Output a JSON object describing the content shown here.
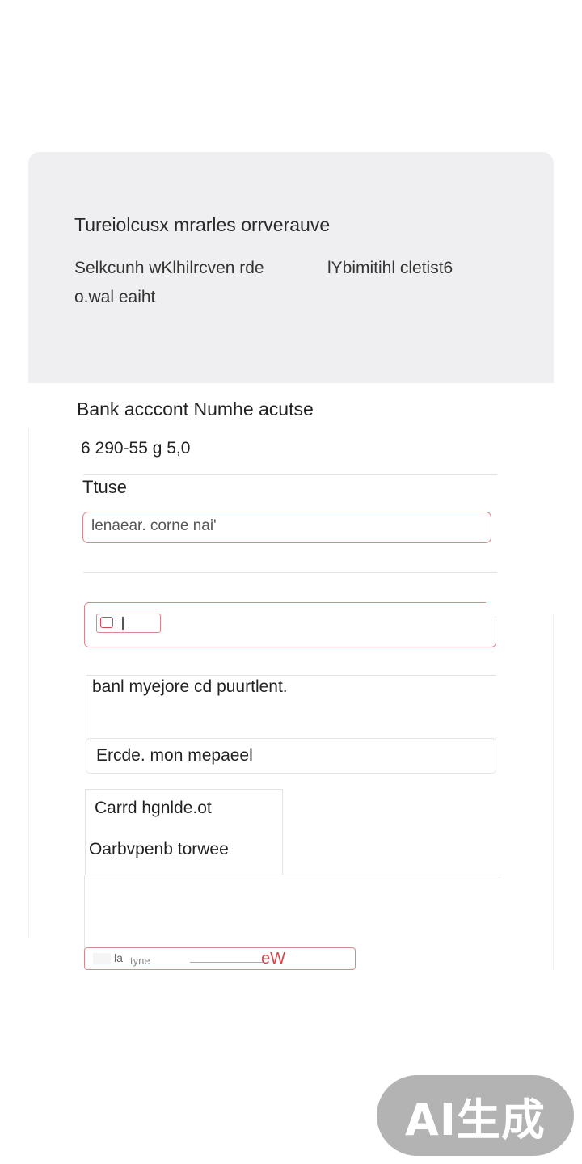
{
  "header": {
    "title": "Tureiolcusx mrarles orrverauve",
    "description_a": "Selkcunh wKlhilrcven rde",
    "description_b": "lYbimitihl cletist6",
    "description_c": "o.wal eaiht"
  },
  "form": {
    "bank_account_label": "Bank acccont Numhe acutse",
    "bank_account_value": "6 290-55 g 5,0",
    "field_label": "Ttuse",
    "field_input_value": "lenaear. corne nai'",
    "note_text": "banl myejore cd puurtlent.",
    "expire_input_value": "Ercde. mon mepaeel",
    "card_holder_label": "Carrd hgnlde.ot",
    "card_number_label": "Oarbvpenb torwee",
    "bottom_strip_a": "la",
    "bottom_strip_b": "tyne",
    "bottom_strip_c": "eW"
  },
  "watermark": {
    "text": "AI生成"
  },
  "colors": {
    "header_bg": "#efeff1",
    "accent_red": "#d78a8e",
    "watermark_bg": "#969696"
  }
}
